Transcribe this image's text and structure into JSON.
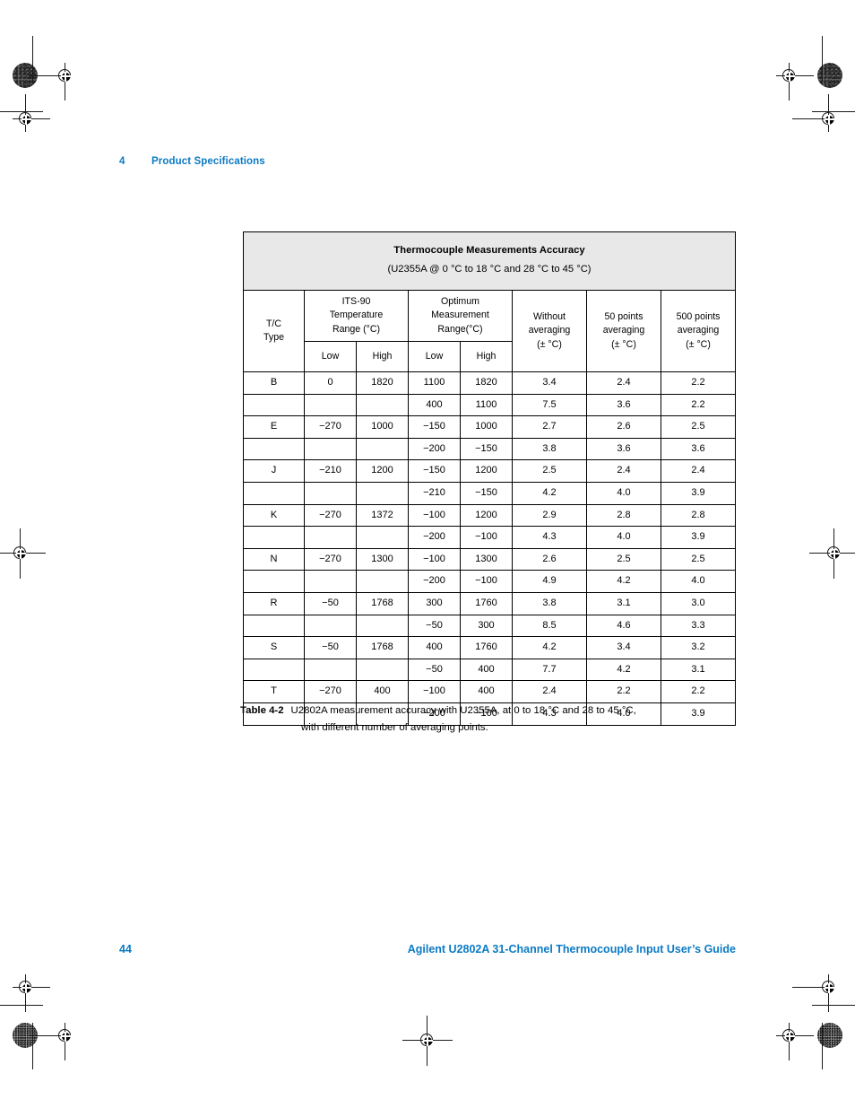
{
  "running_head": {
    "chapter_number": "4",
    "chapter_title": "Product Specifications"
  },
  "table": {
    "title": "Thermocouple Measurements Accuracy",
    "subtitle": "(U2355A @ 0 °C to 18 °C and 28 °C to 45 °C)",
    "headers": {
      "tc_type": "T/C\nType",
      "tc_type_line1": "T/C",
      "tc_type_line2": "Type",
      "its90_line1": "ITS-90",
      "its90_line2": "Temperature",
      "its90_line3": "Range (°C)",
      "optimum_line1": "Optimum",
      "optimum_line2": "Measurement",
      "optimum_line3": "Range(°C)",
      "without_avg_line1": "Without",
      "without_avg_line2": "averaging",
      "without_avg_line3": "(± °C)",
      "p50_line1": "50 points",
      "p50_line2": "averaging",
      "p50_line3": "(± °C)",
      "p500_line1": "500 points",
      "p500_line2": "averaging",
      "p500_line3": "(± °C)",
      "low1": "Low",
      "high1": "High",
      "low2": "Low",
      "high2": "High"
    },
    "rows": [
      {
        "tc": "B",
        "its_low": "0",
        "its_high": "1820",
        "opt_low": "1100",
        "opt_high": "1820",
        "no_avg": "3.4",
        "avg50": "2.4",
        "avg500": "2.2"
      },
      {
        "tc": "",
        "its_low": "",
        "its_high": "",
        "opt_low": "400",
        "opt_high": "1100",
        "no_avg": "7.5",
        "avg50": "3.6",
        "avg500": "2.2"
      },
      {
        "tc": "E",
        "its_low": "−270",
        "its_high": "1000",
        "opt_low": "−150",
        "opt_high": "1000",
        "no_avg": "2.7",
        "avg50": "2.6",
        "avg500": "2.5"
      },
      {
        "tc": "",
        "its_low": "",
        "its_high": "",
        "opt_low": "−200",
        "opt_high": "−150",
        "no_avg": "3.8",
        "avg50": "3.6",
        "avg500": "3.6"
      },
      {
        "tc": "J",
        "its_low": "−210",
        "its_high": "1200",
        "opt_low": "−150",
        "opt_high": "1200",
        "no_avg": "2.5",
        "avg50": "2.4",
        "avg500": "2.4"
      },
      {
        "tc": "",
        "its_low": "",
        "its_high": "",
        "opt_low": "−210",
        "opt_high": "−150",
        "no_avg": "4.2",
        "avg50": "4.0",
        "avg500": "3.9"
      },
      {
        "tc": "K",
        "its_low": "−270",
        "its_high": "1372",
        "opt_low": "−100",
        "opt_high": "1200",
        "no_avg": "2.9",
        "avg50": "2.8",
        "avg500": "2.8"
      },
      {
        "tc": "",
        "its_low": "",
        "its_high": "",
        "opt_low": "−200",
        "opt_high": "−100",
        "no_avg": "4.3",
        "avg50": "4.0",
        "avg500": "3.9"
      },
      {
        "tc": "N",
        "its_low": "−270",
        "its_high": "1300",
        "opt_low": "−100",
        "opt_high": "1300",
        "no_avg": "2.6",
        "avg50": "2.5",
        "avg500": "2.5"
      },
      {
        "tc": "",
        "its_low": "",
        "its_high": "",
        "opt_low": "−200",
        "opt_high": "−100",
        "no_avg": "4.9",
        "avg50": "4.2",
        "avg500": "4.0"
      },
      {
        "tc": "R",
        "its_low": "−50",
        "its_high": "1768",
        "opt_low": "300",
        "opt_high": "1760",
        "no_avg": "3.8",
        "avg50": "3.1",
        "avg500": "3.0"
      },
      {
        "tc": "",
        "its_low": "",
        "its_high": "",
        "opt_low": "−50",
        "opt_high": "300",
        "no_avg": "8.5",
        "avg50": "4.6",
        "avg500": "3.3"
      },
      {
        "tc": "S",
        "its_low": "−50",
        "its_high": "1768",
        "opt_low": "400",
        "opt_high": "1760",
        "no_avg": "4.2",
        "avg50": "3.4",
        "avg500": "3.2"
      },
      {
        "tc": "",
        "its_low": "",
        "its_high": "",
        "opt_low": "−50",
        "opt_high": "400",
        "no_avg": "7.7",
        "avg50": "4.2",
        "avg500": "3.1"
      },
      {
        "tc": "T",
        "its_low": "−270",
        "its_high": "400",
        "opt_low": "−100",
        "opt_high": "400",
        "no_avg": "2.4",
        "avg50": "2.2",
        "avg500": "2.2"
      },
      {
        "tc": "",
        "its_low": "",
        "its_high": "",
        "opt_low": "−200",
        "opt_high": "−100",
        "no_avg": "4.3",
        "avg50": "4.0",
        "avg500": "3.9"
      }
    ]
  },
  "caption": {
    "label": "Table 4-2",
    "line1": "U2802A measurement accuracy with U2355A, at 0 to 18 °C and 28 to 45  °C,",
    "line2": "with different number of averaging points."
  },
  "footer": {
    "page_number": "44",
    "document_title": "Agilent U2802A 31-Channel Thermocouple Input User’s Guide"
  },
  "colors": {
    "accent_blue": "#0b7ac4",
    "title_band_gray": "#e8e8e8",
    "rule_black": "#000000"
  }
}
